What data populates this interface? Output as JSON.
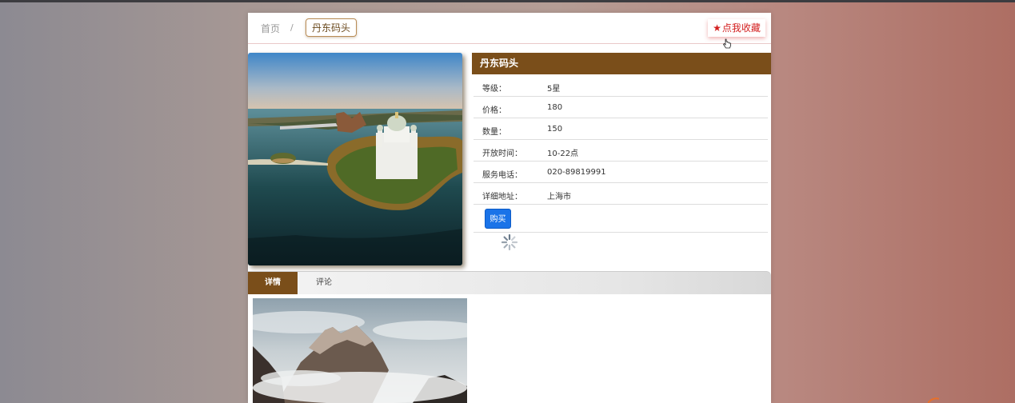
{
  "breadcrumb": {
    "home": "首页",
    "separator": "/",
    "current": "丹东码头"
  },
  "collect": {
    "icon": "star-icon",
    "label": "点我收藏",
    "color": "#d31f1f"
  },
  "product": {
    "title": "丹东码头",
    "rows": [
      {
        "label": "等级：",
        "value": "5星"
      },
      {
        "label": "价格：",
        "value": "180"
      },
      {
        "label": "数量：",
        "value": "150"
      },
      {
        "label": "开放时间：",
        "value": "10-22点"
      },
      {
        "label": "服务电话：",
        "value": "020-89819991"
      },
      {
        "label": "详细地址：",
        "value": "上海市"
      }
    ],
    "buy_label": "购买"
  },
  "tabs": [
    {
      "label": "详情",
      "active": true
    },
    {
      "label": "评论",
      "active": false
    }
  ],
  "colors": {
    "accent": "#7a4e1a",
    "buy": "#1a73e8"
  }
}
